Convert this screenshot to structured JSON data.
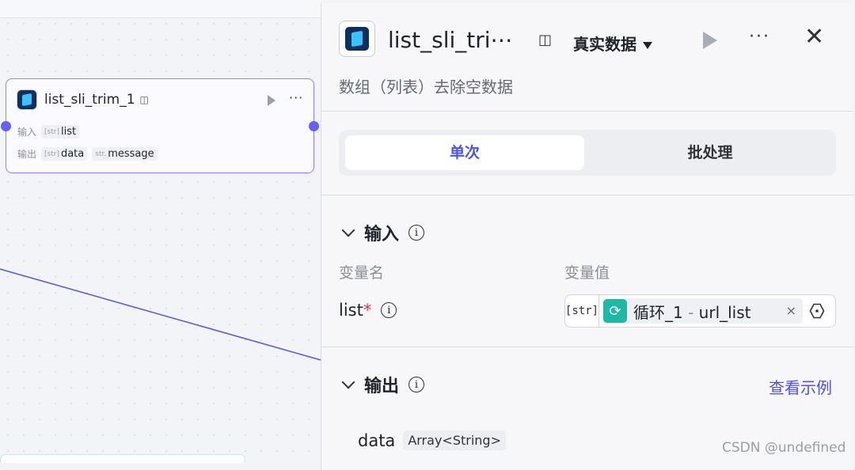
{
  "canvas": {
    "node": {
      "title": "list_sli_trim_1",
      "input_label": "输入",
      "output_label": "输出",
      "inputs": [
        {
          "type": "[str]",
          "name": "list"
        }
      ],
      "outputs": [
        {
          "type": "[str]",
          "name": "data"
        },
        {
          "type": "str.",
          "name": "message"
        }
      ],
      "icons": {
        "node": "tool-icon",
        "store": "store-icon",
        "run": "play-icon",
        "more": "more-icon"
      }
    }
  },
  "panel": {
    "title": "list_sli_tri⋯",
    "env_label": "真实数据",
    "description": "数组（列表）去除空数据",
    "close_glyph": "✕",
    "more_glyph": "···",
    "modes": {
      "single": "单次",
      "batch": "批处理"
    },
    "input_section": {
      "title": "输入",
      "col_name": "变量名",
      "col_value": "变量值",
      "rows": [
        {
          "name": "list",
          "required_mark": "*",
          "type": "[str]",
          "ref_node": "循环_1",
          "ref_sep": " - ",
          "ref_var": "url_list",
          "clear": "×"
        }
      ]
    },
    "output_section": {
      "title": "输出",
      "example_link": "查看示例",
      "rows": [
        {
          "name": "data",
          "type": "Array<String>"
        }
      ]
    }
  },
  "watermark": "CSDN @undefined",
  "colors": {
    "accent": "#4d53e8",
    "edge": "#5b5ce8",
    "loop": "#1fb8a5"
  }
}
